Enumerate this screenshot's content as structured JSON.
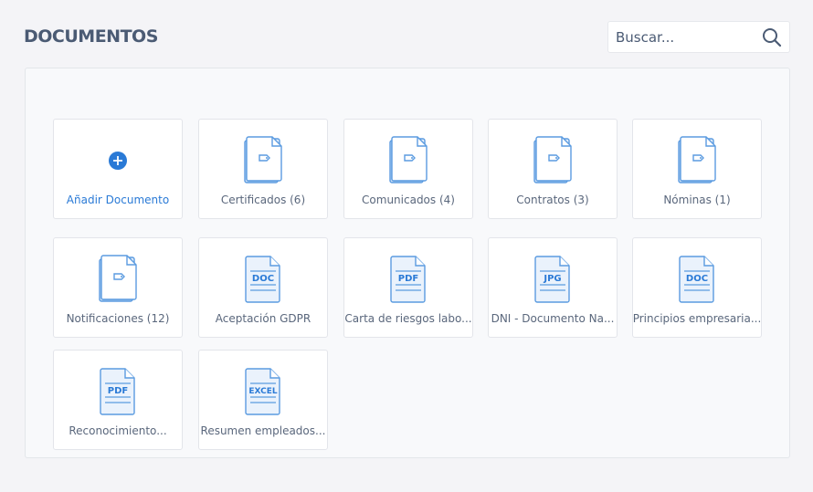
{
  "header": {
    "title": "DOCUMENTOS",
    "search_placeholder": "Buscar..."
  },
  "add_label": "Añadir Documento",
  "folders": [
    {
      "label": "Certificados (6)"
    },
    {
      "label": "Comunicados (4)"
    },
    {
      "label": "Contratos (3)"
    },
    {
      "label": "Nóminas (1)"
    },
    {
      "label": "Notificaciones (12)"
    }
  ],
  "files": [
    {
      "label": "Aceptación GDPR",
      "type": "DOC"
    },
    {
      "label": "Carta de riesgos labo...",
      "type": "PDF"
    },
    {
      "label": "DNI - Documento Na...",
      "type": "JPG"
    },
    {
      "label": "Principios empresaria...",
      "type": "DOC"
    },
    {
      "label": "Reconocimiento...",
      "type": "PDF"
    },
    {
      "label": "Resumen empleados...",
      "type": "EXCEL"
    }
  ],
  "colors": {
    "accent": "#2a7ad6",
    "icon": "#5b9be0"
  }
}
